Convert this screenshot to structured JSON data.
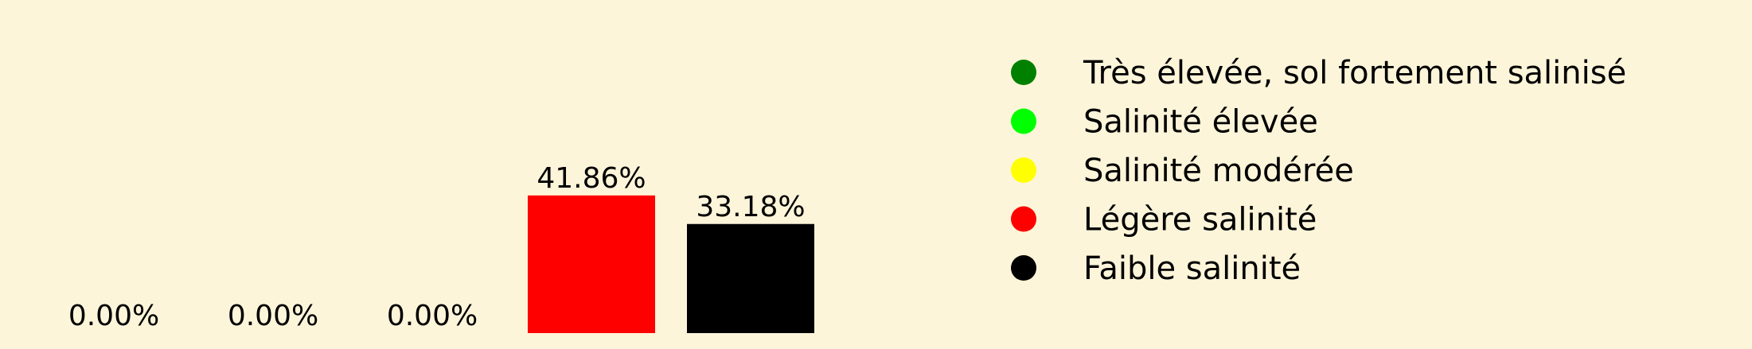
{
  "background_color": "#fdf5d9",
  "chart_data": {
    "type": "bar",
    "categories": [
      "Très élevée, sol fortement salinisé",
      "Salinité élevée",
      "Salinité modérée",
      "Légère salinité",
      "Faible salinité"
    ],
    "values": [
      0.0,
      0.0,
      0.0,
      41.86,
      33.18
    ],
    "value_labels": [
      "0.00%",
      "0.00%",
      "0.00%",
      "41.86%",
      "33.18%"
    ],
    "colors": [
      "#008000",
      "#00ff00",
      "#ffff00",
      "#ff0000",
      "#000000"
    ],
    "unit": "%",
    "ylim": [
      0,
      44
    ],
    "grid": false,
    "axes_visible": false,
    "legend": {
      "placement": "right",
      "marker": "circle",
      "entries": [
        {
          "label": "Très élevée, sol fortement salinisé",
          "color": "#008000"
        },
        {
          "label": "Salinité élevée",
          "color": "#00ff00"
        },
        {
          "label": "Salinité modérée",
          "color": "#ffff00"
        },
        {
          "label": "Légère salinité",
          "color": "#ff0000"
        },
        {
          "label": "Faible salinité",
          "color": "#000000"
        }
      ]
    }
  }
}
